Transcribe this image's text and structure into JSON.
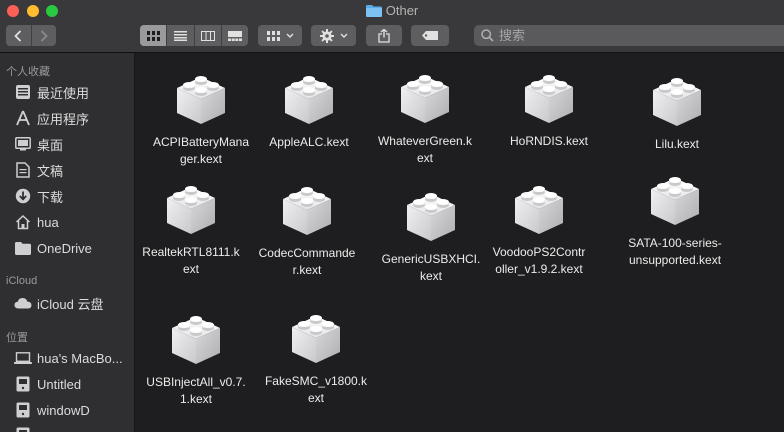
{
  "window": {
    "title": "Other",
    "folder_icon": "folder-icon"
  },
  "toolbar": {
    "back_icon": "chevron-left-icon",
    "forward_icon": "chevron-right-icon",
    "search_placeholder": "搜索"
  },
  "sidebar": {
    "favorites_header": "个人收藏",
    "favorites": [
      {
        "label": "最近使用",
        "icon": "recents-icon"
      },
      {
        "label": "应用程序",
        "icon": "applications-icon"
      },
      {
        "label": "桌面",
        "icon": "desktop-icon"
      },
      {
        "label": "文稿",
        "icon": "documents-icon"
      },
      {
        "label": "下载",
        "icon": "downloads-icon"
      },
      {
        "label": "hua",
        "icon": "home-icon"
      },
      {
        "label": "OneDrive",
        "icon": "folder-icon"
      }
    ],
    "icloud_header": "iCloud",
    "icloud": [
      {
        "label": "iCloud 云盘",
        "icon": "cloud-icon"
      }
    ],
    "locations_header": "位置",
    "locations": [
      {
        "label": "hua's MacBo...",
        "icon": "laptop-icon"
      },
      {
        "label": "Untitled",
        "icon": "disk-icon"
      },
      {
        "label": "windowD",
        "icon": "disk-icon"
      },
      {
        "label": "",
        "icon": "disk-icon"
      }
    ]
  },
  "files": [
    {
      "line1": "ACPIBatteryMana",
      "line2": "ger.kext"
    },
    {
      "line1": "AppleALC.kext",
      "line2": ""
    },
    {
      "line1": "WhateverGreen.k",
      "line2": "ext"
    },
    {
      "line1": "HoRNDIS.kext",
      "line2": ""
    },
    {
      "line1": "Lilu.kext",
      "line2": ""
    },
    {
      "line1": "RealtekRTL8111.k",
      "line2": "ext"
    },
    {
      "line1": "CodecCommande",
      "line2": "r.kext"
    },
    {
      "line1": "GenericUSBXHCI.",
      "line2": "kext"
    },
    {
      "line1": "VoodooPS2Contr",
      "line2": "oller_v1.9.2.kext"
    },
    {
      "line1": "SATA-100-series-",
      "line2": "unsupported.kext"
    },
    {
      "line1": "USBInjectAll_v0.7.",
      "line2": "1.kext"
    },
    {
      "line1": "FakeSMC_v1800.k",
      "line2": "ext"
    }
  ]
}
